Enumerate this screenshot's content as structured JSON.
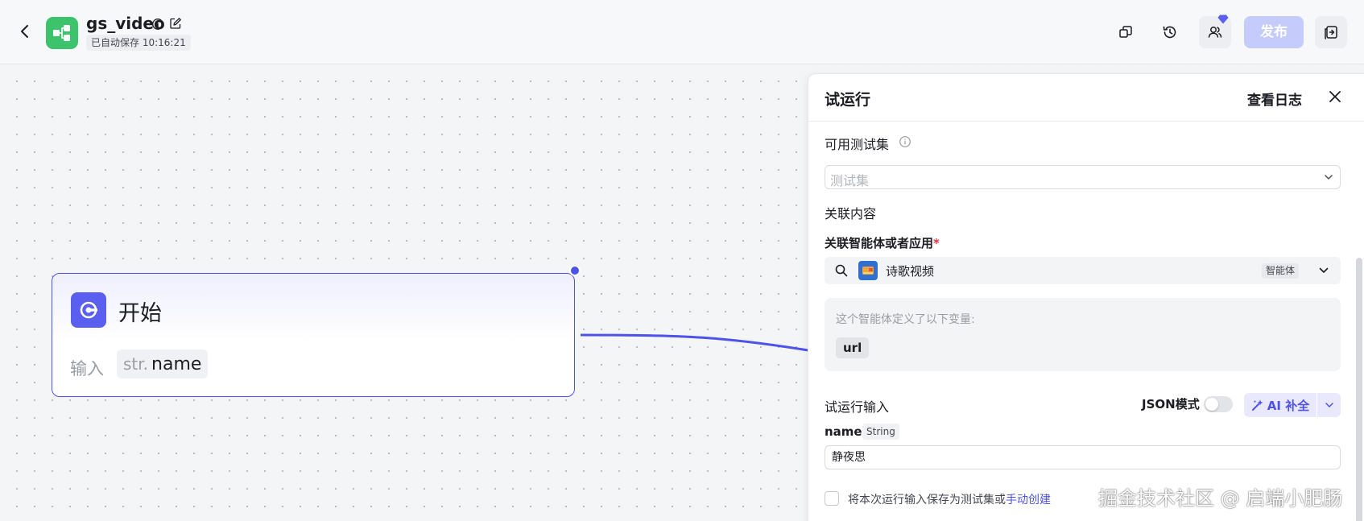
{
  "header": {
    "app_name": "gs_video",
    "autosave": "已自动保存 10:16:21",
    "publish_label": "发布"
  },
  "canvas": {
    "start_node": {
      "title": "开始",
      "input_label": "输入",
      "var_type": "str.",
      "var_name": "name"
    }
  },
  "panel": {
    "title": "试运行",
    "view_log": "查看日志",
    "testset_label": "可用测试集",
    "testset_placeholder": "测试集",
    "related_content_label": "关联内容",
    "related_agent_label": "关联智能体或者应用",
    "required_mark": "*",
    "agent_name": "诗歌视频",
    "agent_tag": "智能体",
    "vars_desc": "这个智能体定义了以下变量:",
    "var_chip": "url",
    "trial_input_label": "试运行输入",
    "json_mode_label": "JSON模式",
    "json_mode_on": false,
    "ai_fill_label": "AI 补全",
    "field_name": "name",
    "field_type": "String",
    "field_value": "静夜思",
    "save_text": "将本次运行输入保存为测试集或",
    "save_link": "手动创建"
  },
  "watermark": "掘金技术社区 @ 启端小肥肠",
  "colors": {
    "accent": "#4d53e8",
    "app_logo": "#3cc36b",
    "publish_disabled": "#c5cbfb",
    "node_icon": "#5b5ff0"
  }
}
